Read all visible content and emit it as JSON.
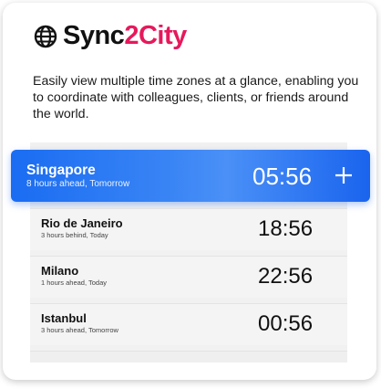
{
  "app": {
    "brand_main": "Sync",
    "brand_accent": "2City",
    "brand_accent_color": "#e6195c",
    "logo_icon": "globe-icon",
    "description": "Easily view multiple time zones at a glance, enabling you to coordinate with colleagues, clients, or friends around the world."
  },
  "featured": {
    "city": "Singapore",
    "offset": "8 hours ahead, Tomorrow",
    "time": "05:56",
    "add_icon": "plus-icon",
    "color": "#1a6cf2"
  },
  "zones": [
    {
      "city": "Rio de Janeiro",
      "offset": "3 hours behind, Today",
      "time": "18:56"
    },
    {
      "city": "Milano",
      "offset": "1 hours ahead, Today",
      "time": "22:56"
    },
    {
      "city": "Istanbul",
      "offset": "3 hours ahead, Tomorrow",
      "time": "00:56"
    }
  ]
}
